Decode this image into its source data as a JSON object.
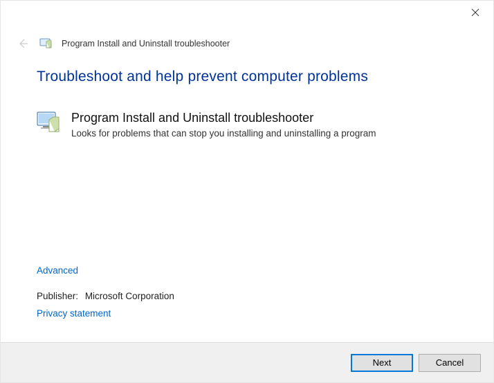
{
  "window": {
    "header_title": "Program Install and Uninstall troubleshooter"
  },
  "page": {
    "heading": "Troubleshoot and help prevent computer problems",
    "item_title": "Program Install and Uninstall troubleshooter",
    "item_desc": "Looks for problems that can stop you installing and uninstalling a program"
  },
  "links": {
    "advanced": "Advanced",
    "publisher_label": "Publisher:",
    "publisher_name": "Microsoft Corporation",
    "privacy": "Privacy statement"
  },
  "footer": {
    "next": "Next",
    "cancel": "Cancel"
  }
}
